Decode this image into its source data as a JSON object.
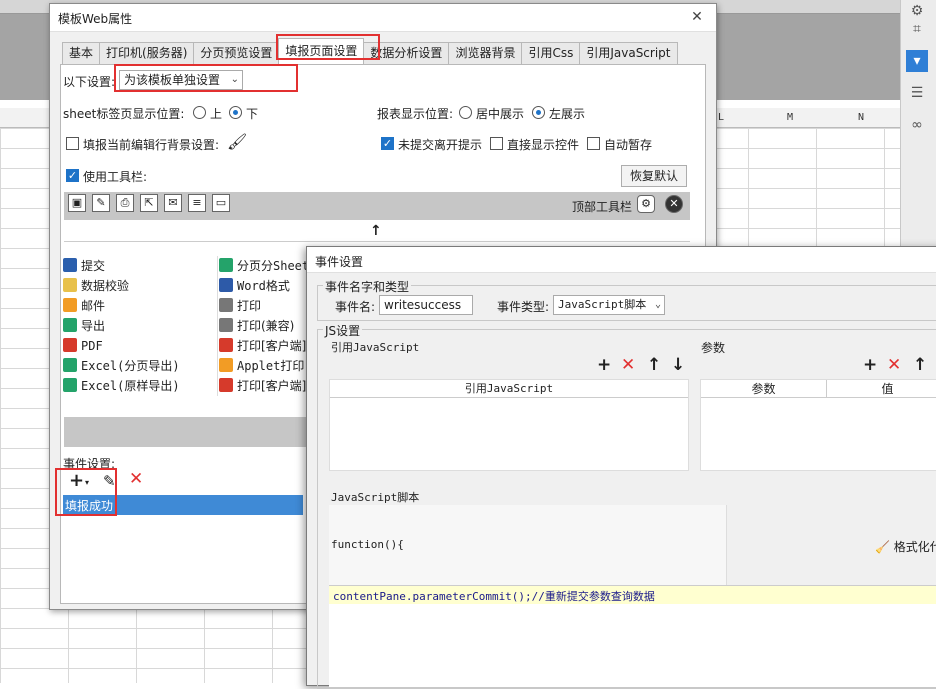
{
  "background": {
    "columns": [
      "L",
      "M",
      "N"
    ]
  },
  "dialog1": {
    "title": "模板Web属性",
    "close_glyph": "✕",
    "tabs": [
      "基本",
      "打印机(服务器)",
      "分页预览设置",
      "填报页面设置",
      "数据分析设置",
      "浏览器背景",
      "引用Css",
      "引用JavaScript"
    ],
    "active_tab_index": 3,
    "settings_label": "以下设置:",
    "settings_value": "为该模板单独设置",
    "sheet_pos_label": "sheet标签页显示位置:",
    "sheet_pos_opt1": "上",
    "sheet_pos_opt2": "下",
    "report_pos_label": "报表显示位置:",
    "report_pos_opt1": "居中展示",
    "report_pos_opt2": "左展示",
    "fill_bg_label": "填报当前编辑行背景设置:",
    "unsubmit_label": "未提交离开提示",
    "direct_show_label": "直接显示控件",
    "autosave_label": "自动暂存",
    "use_toolbar_label": "使用工具栏:",
    "restore_default": "恢复默认",
    "top_toolbar_label": "顶部工具栏",
    "up_arrow": "↑",
    "list_left": [
      "提交",
      "数据校验",
      "邮件",
      "导出",
      "PDF",
      "Excel(分页导出)",
      "Excel(原样导出)"
    ],
    "list_right": [
      "分页分Sheet",
      "Word格式",
      "打印",
      "打印(兼容)",
      "打印[客户端]",
      "Applet打印",
      "打印[客户端]"
    ],
    "event_label": "事件设置:",
    "event_items": [
      "填报成功"
    ]
  },
  "dialog2": {
    "title": "事件设置",
    "group_name_type": "事件名字和类型",
    "event_name_label": "事件名:",
    "event_name_value": "writesuccess",
    "event_type_label": "事件类型:",
    "event_type_value": "JavaScript脚本",
    "js_settings": "JS设置",
    "ref_js_label": "引用JavaScript",
    "params_label": "参数",
    "ref_js_col": "引用JavaScript",
    "param_col": "参数",
    "value_col": "值",
    "js_script_label": "JavaScript脚本",
    "function_open": "function(){",
    "format_label": "格式化代",
    "code_line": "contentPane.parameterCommit();//重新提交参数查询数据"
  },
  "colors": {
    "accent": "#1e73c8",
    "highlight_red": "#e23030",
    "selection": "#3f8ad6",
    "code_bg": "#ffffd0"
  }
}
